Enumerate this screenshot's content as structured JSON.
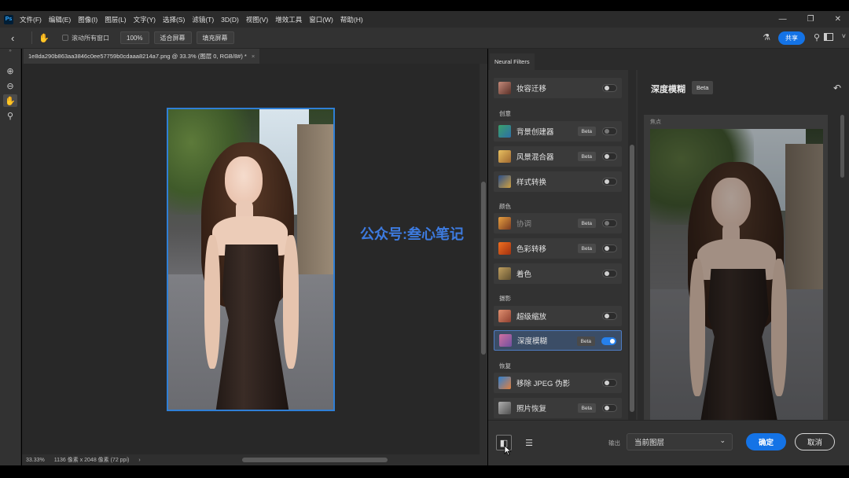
{
  "app": {
    "logo": "Ps",
    "menu": [
      "文件(F)",
      "编辑(E)",
      "图像(I)",
      "图层(L)",
      "文字(Y)",
      "选择(S)",
      "滤镜(T)",
      "3D(D)",
      "视图(V)",
      "增效工具",
      "窗口(W)",
      "帮助(H)"
    ],
    "window_controls": [
      "minimize-icon",
      "restore-icon",
      "close-icon"
    ]
  },
  "options_bar": {
    "scroll_all_windows": "滚动所有窗口",
    "zoom_100": "100%",
    "fit_screen": "适合屏幕",
    "fill_screen": "填充屏幕",
    "share": "共享"
  },
  "document": {
    "tab_title": "1e8da290b863aa3846c0ee57759b0cdaaa8214a7.png @ 33.3% (图层 0, RGB/8#) *",
    "zoom": "33.33%",
    "size_info": "1136 像素 x 2048 像素 (72 ppi)"
  },
  "neural_filters": {
    "panel_tab": "Neural Filters",
    "categories": {
      "creative": "创意",
      "color": "颜色",
      "photography": "摄影",
      "restore": "恢复"
    },
    "filters": {
      "makeup_transfer": "妆容迁移",
      "background_creator": "背景创建器",
      "landscape_mixer": "风景混合器",
      "style_transfer": "样式转换",
      "harmonization": "协调",
      "color_transfer": "色彩转移",
      "colorize": "着色",
      "super_zoom": "超级缩放",
      "depth_blur": "深度模糊",
      "jpeg_artifacts": "移除 JPEG 伪影",
      "photo_restore": "照片恢复"
    },
    "beta": "Beta",
    "detail_title": "深度模糊",
    "focus_label": "焦点",
    "output_label": "输出",
    "output_value": "当前图层",
    "ok": "确定",
    "cancel": "取消"
  },
  "watermark": "公众号:叁心笔记",
  "colors": {
    "accent": "#1473e6",
    "selected_bg": "#3b4d66",
    "watermark": "#3d7be0"
  }
}
